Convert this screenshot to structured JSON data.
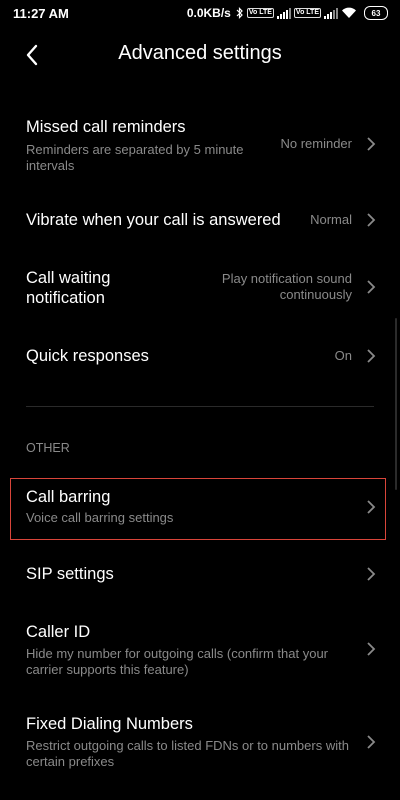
{
  "status_bar": {
    "time": "11:27 AM",
    "speed": "0.0KB/s",
    "volte": "Vo LTE",
    "battery": "63"
  },
  "header": {
    "title": "Advanced settings"
  },
  "settings": {
    "missed_call": {
      "title": "Missed call reminders",
      "subtitle": "Reminders are separated by 5 minute intervals",
      "value": "No reminder"
    },
    "vibrate": {
      "title": "Vibrate when your call is answered",
      "value": "Normal"
    },
    "call_waiting": {
      "title": "Call waiting notification",
      "value": "Play notification sound continuously"
    },
    "quick_responses": {
      "title": "Quick responses",
      "value": "On"
    }
  },
  "other_section": {
    "header": "OTHER",
    "call_barring": {
      "title": "Call barring",
      "subtitle": "Voice call barring settings"
    },
    "sip_settings": {
      "title": "SIP settings"
    },
    "caller_id": {
      "title": "Caller ID",
      "subtitle": "Hide my number for outgoing calls (confirm that your carrier supports this feature)"
    },
    "fdn": {
      "title": "Fixed Dialing Numbers",
      "subtitle": "Restrict outgoing calls to listed FDNs or to numbers with certain prefixes"
    }
  },
  "highlight_color": "#d9453a",
  "icons": [
    "back-arrow-icon",
    "chevron-right-icon",
    "bluetooth-icon",
    "signal-icon",
    "wifi-icon",
    "battery-icon"
  ]
}
